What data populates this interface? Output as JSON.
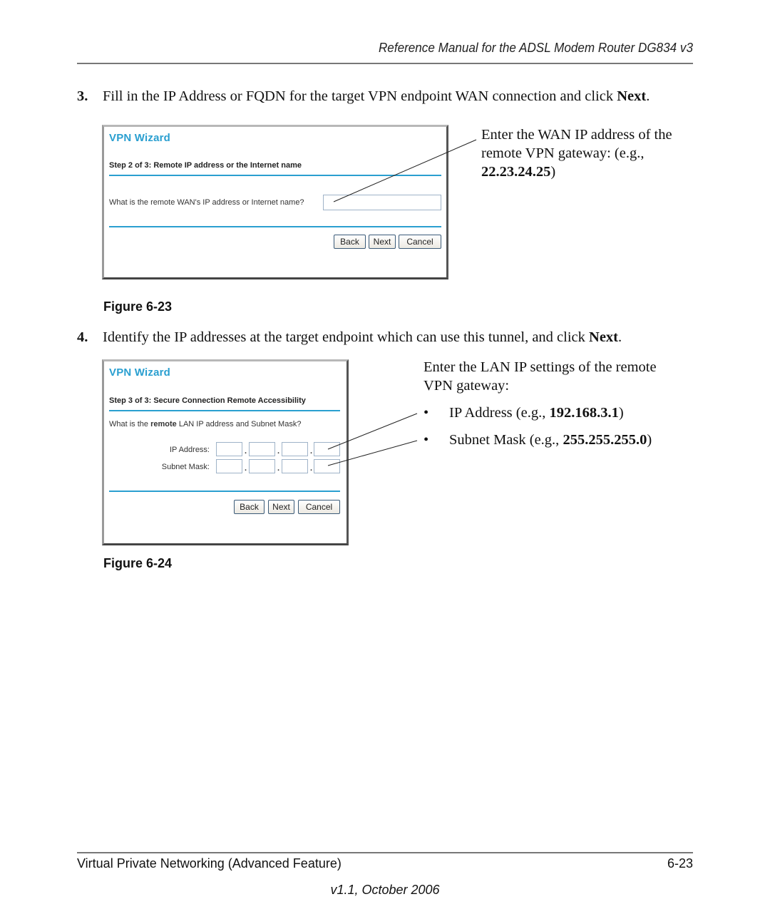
{
  "header": {
    "title": "Reference Manual for the ADSL Modem Router DG834 v3"
  },
  "steps": [
    {
      "number": "3.",
      "text_before": "Fill in the IP Address or FQDN for the target VPN endpoint WAN connection and click ",
      "bold": "Next",
      "text_after": "."
    },
    {
      "number": "4.",
      "text_before": "Identify the IP addresses at the target endpoint which can use this tunnel, and click ",
      "bold": "Next",
      "text_after": "."
    }
  ],
  "figure23": {
    "caption": "Figure 6-23",
    "wizard": {
      "title": "VPN Wizard",
      "step_label": "Step 2 of 3: Remote IP address or the Internet name",
      "question": "What is the remote WAN's IP address or Internet name?",
      "input_value": "",
      "buttons": {
        "back": "Back",
        "next": "Next",
        "cancel": "Cancel"
      }
    },
    "callout": {
      "line1": "Enter the WAN IP address of the",
      "line2": "remote VPN gateway: (e.g.,",
      "example": "22.23.24.25",
      "close": ")"
    }
  },
  "figure24": {
    "caption": "Figure 6-24",
    "wizard": {
      "title": "VPN Wizard",
      "step_label": "Step 3 of 3: Secure Connection Remote Accessibility",
      "question_before": "What is the ",
      "question_bold": "remote",
      "question_after": " LAN IP address and Subnet Mask?",
      "ip_label": "IP Address:",
      "mask_label": "Subnet Mask:",
      "ip_octets": [
        "",
        "",
        "",
        ""
      ],
      "mask_octets": [
        "",
        "",
        "",
        ""
      ],
      "separator": ".",
      "buttons": {
        "back": "Back",
        "next": "Next",
        "cancel": "Cancel"
      }
    },
    "callout": {
      "intro_line1": "Enter the LAN IP settings of the remote",
      "intro_line2": "VPN gateway:",
      "bullet": "•",
      "items": [
        {
          "label": "IP Address (e.g., ",
          "example": "192.168.3.1",
          "close": ")"
        },
        {
          "label": "Subnet Mask (e.g., ",
          "example": "255.255.255.0",
          "close": ")"
        }
      ]
    }
  },
  "footer": {
    "section": "Virtual Private Networking (Advanced Feature)",
    "page": "6-23",
    "version": "v1.1, October 2006"
  },
  "colors": {
    "wizard_accent": "#2a9fd0"
  }
}
